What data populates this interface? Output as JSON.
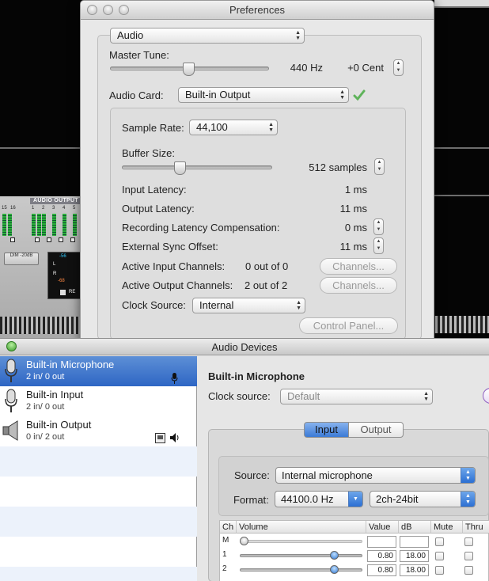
{
  "background": {
    "mixer_title": "AUDIO OUTPUT",
    "channel_numbers": [
      "15",
      "16",
      "1",
      "2",
      "3",
      "4",
      "5"
    ],
    "dim_button": "DIM -20dB",
    "lcd_values": [
      "-56",
      "-68",
      "L",
      "R",
      "RE"
    ]
  },
  "preferences": {
    "title": "Preferences",
    "category": "Audio",
    "master_tune_label": "Master Tune:",
    "master_tune_hz": "440 Hz",
    "master_tune_cent": "+0 Cent",
    "audio_card_label": "Audio Card:",
    "audio_card_value": "Built-in Output",
    "sample_rate_label": "Sample Rate:",
    "sample_rate_value": "44,100",
    "buffer_size_label": "Buffer Size:",
    "buffer_size_value": "512 samples",
    "input_latency_label": "Input Latency:",
    "input_latency_value": "1 ms",
    "output_latency_label": "Output Latency:",
    "output_latency_value": "11 ms",
    "rec_comp_label": "Recording Latency Compensation:",
    "rec_comp_value": "0 ms",
    "ext_sync_label": "External Sync Offset:",
    "ext_sync_value": "11 ms",
    "active_input_label": "Active Input Channels:",
    "active_input_value": "0 out of 0",
    "active_output_label": "Active Output Channels:",
    "active_output_value": "2 out of 2",
    "channels_button": "Channels...",
    "clock_source_label": "Clock Source:",
    "clock_source_value": "Internal",
    "control_panel_button": "Control Panel..."
  },
  "audio_devices": {
    "title": "Audio Devices",
    "devices": [
      {
        "name": "Built-in Microphone",
        "io": "2 in/ 0 out",
        "selected": true
      },
      {
        "name": "Built-in Input",
        "io": "2 in/ 0 out",
        "selected": false
      },
      {
        "name": "Built-in Output",
        "io": "0 in/ 2 out",
        "selected": false
      }
    ],
    "detail_title": "Built-in Microphone",
    "clock_source_label": "Clock source:",
    "clock_source_value": "Default",
    "tabs": [
      "Input",
      "Output"
    ],
    "active_tab": "Input",
    "source_label": "Source:",
    "source_value": "Internal microphone",
    "format_label": "Format:",
    "format_rate": "44100.0 Hz",
    "format_bits": "2ch-24bit",
    "table": {
      "headers": [
        "Ch",
        "Volume",
        "Value",
        "dB",
        "Mute",
        "Thru"
      ],
      "rows": [
        {
          "ch": "M",
          "value": "",
          "db": ""
        },
        {
          "ch": "1",
          "value": "0.80",
          "db": "18.00"
        },
        {
          "ch": "2",
          "value": "0.80",
          "db": "18.00"
        }
      ]
    }
  },
  "colors": {
    "selection_blue": "#2e66c4",
    "checkmark_green": "#4caf50"
  }
}
